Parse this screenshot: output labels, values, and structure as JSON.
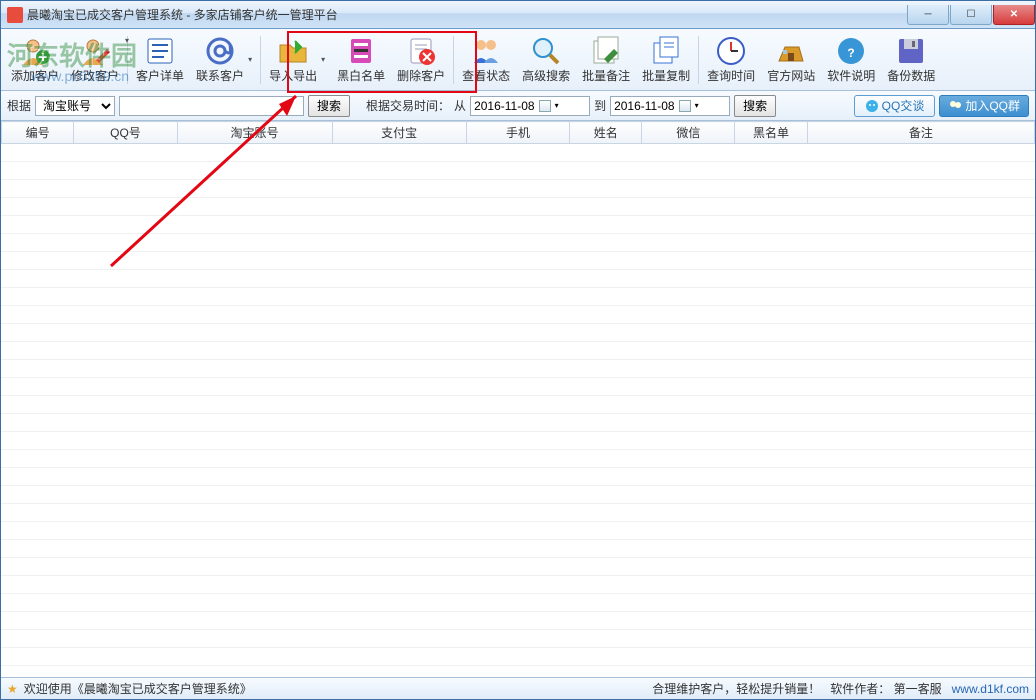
{
  "titlebar": {
    "title": "晨曦淘宝已成交客户管理系统 - 多家店铺客户统一管理平台"
  },
  "toolbar": {
    "items": [
      {
        "label": "添加客户",
        "icon": "add-user"
      },
      {
        "label": "修改客户",
        "icon": "edit-user"
      },
      {
        "label": "客户详单",
        "icon": "detail"
      },
      {
        "label": "联系客户",
        "icon": "at"
      },
      {
        "label": "导入导出",
        "icon": "folder-io"
      },
      {
        "label": "黑白名单",
        "icon": "bw-list"
      },
      {
        "label": "删除客户",
        "icon": "delete"
      },
      {
        "label": "查看状态",
        "icon": "view-status"
      },
      {
        "label": "高级搜索",
        "icon": "adv-search"
      },
      {
        "label": "批量备注",
        "icon": "batch-note"
      },
      {
        "label": "批量复制",
        "icon": "batch-copy"
      },
      {
        "label": "查询时间",
        "icon": "clock"
      },
      {
        "label": "官方网站",
        "icon": "website"
      },
      {
        "label": "软件说明",
        "icon": "help"
      },
      {
        "label": "备份数据",
        "icon": "backup"
      }
    ]
  },
  "filter": {
    "label_basis": "根据",
    "select_value": "淘宝账号",
    "search_btn": "搜索",
    "label_time": "根据交易时间：",
    "label_from": "从",
    "date_from": "2016-11-08",
    "label_to": "到",
    "date_to": "2016-11-08",
    "search_btn2": "搜索",
    "qq_chat": "QQ交谈",
    "qq_join": "加入QQ群"
  },
  "table": {
    "columns": [
      "编号",
      "QQ号",
      "淘宝账号",
      "支付宝",
      "手机",
      "姓名",
      "微信",
      "黑名单",
      "备注"
    ]
  },
  "statusbar": {
    "welcome": "欢迎使用《晨曦淘宝已成交客户管理系统》",
    "slogan": "合理维护客户，轻松提升销量！",
    "author_label": "软件作者：",
    "author": "第一客服",
    "url": "www.d1kf.com"
  },
  "watermark": {
    "main": "河东软件园",
    "sub": "www.pc0359.cn"
  },
  "icons": {
    "add-user": "#3ca33c",
    "edit-user": "#d94f3a",
    "detail": "#2a62b8",
    "at": "#4a6ec5",
    "folder-io": "#eab53b",
    "bw-list": "#d74bb8",
    "delete": "#e33",
    "view-status": "#3972d6",
    "adv-search": "#2f91cf",
    "batch-note": "#3d8e3d",
    "batch-copy": "#3972d6",
    "clock": "#3a5cc6",
    "website": "#d99a2a",
    "help": "#3895d6",
    "backup": "#6065c5"
  }
}
